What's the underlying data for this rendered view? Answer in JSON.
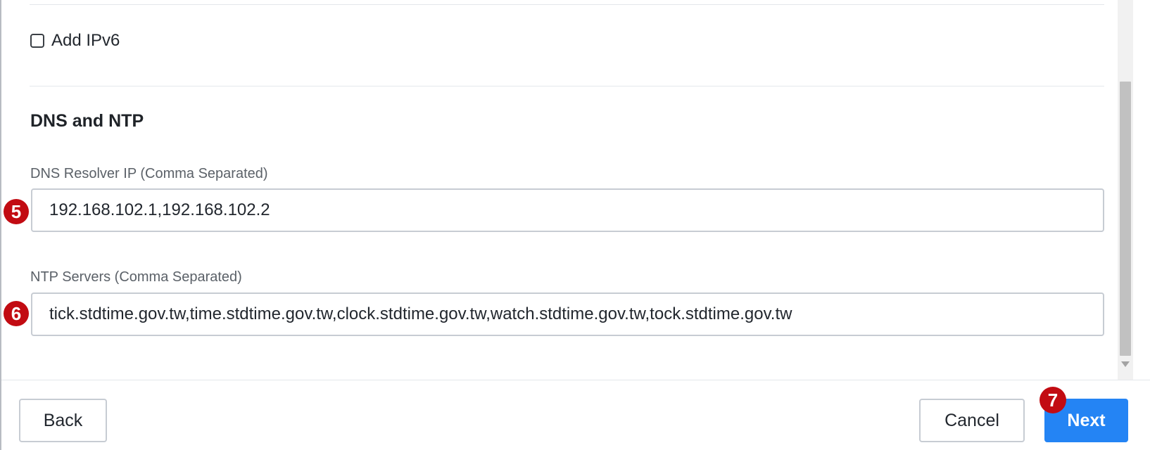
{
  "network": {
    "add_ipv6_label": "Add IPv6",
    "add_ipv6_checked": false
  },
  "dns_ntp": {
    "section_title": "DNS and NTP",
    "dns_label": "DNS Resolver IP (Comma Separated)",
    "dns_value": "192.168.102.1,192.168.102.2",
    "ntp_label": "NTP Servers (Comma Separated)",
    "ntp_value": "tick.stdtime.gov.tw,time.stdtime.gov.tw,clock.stdtime.gov.tw,watch.stdtime.gov.tw,tock.stdtime.gov.tw"
  },
  "annotations": {
    "step_dns": "5",
    "step_ntp": "6",
    "step_next": "7"
  },
  "footer": {
    "back_label": "Back",
    "cancel_label": "Cancel",
    "next_label": "Next"
  },
  "colors": {
    "primary_button": "#2484f4",
    "step_badge": "#c20b12"
  }
}
